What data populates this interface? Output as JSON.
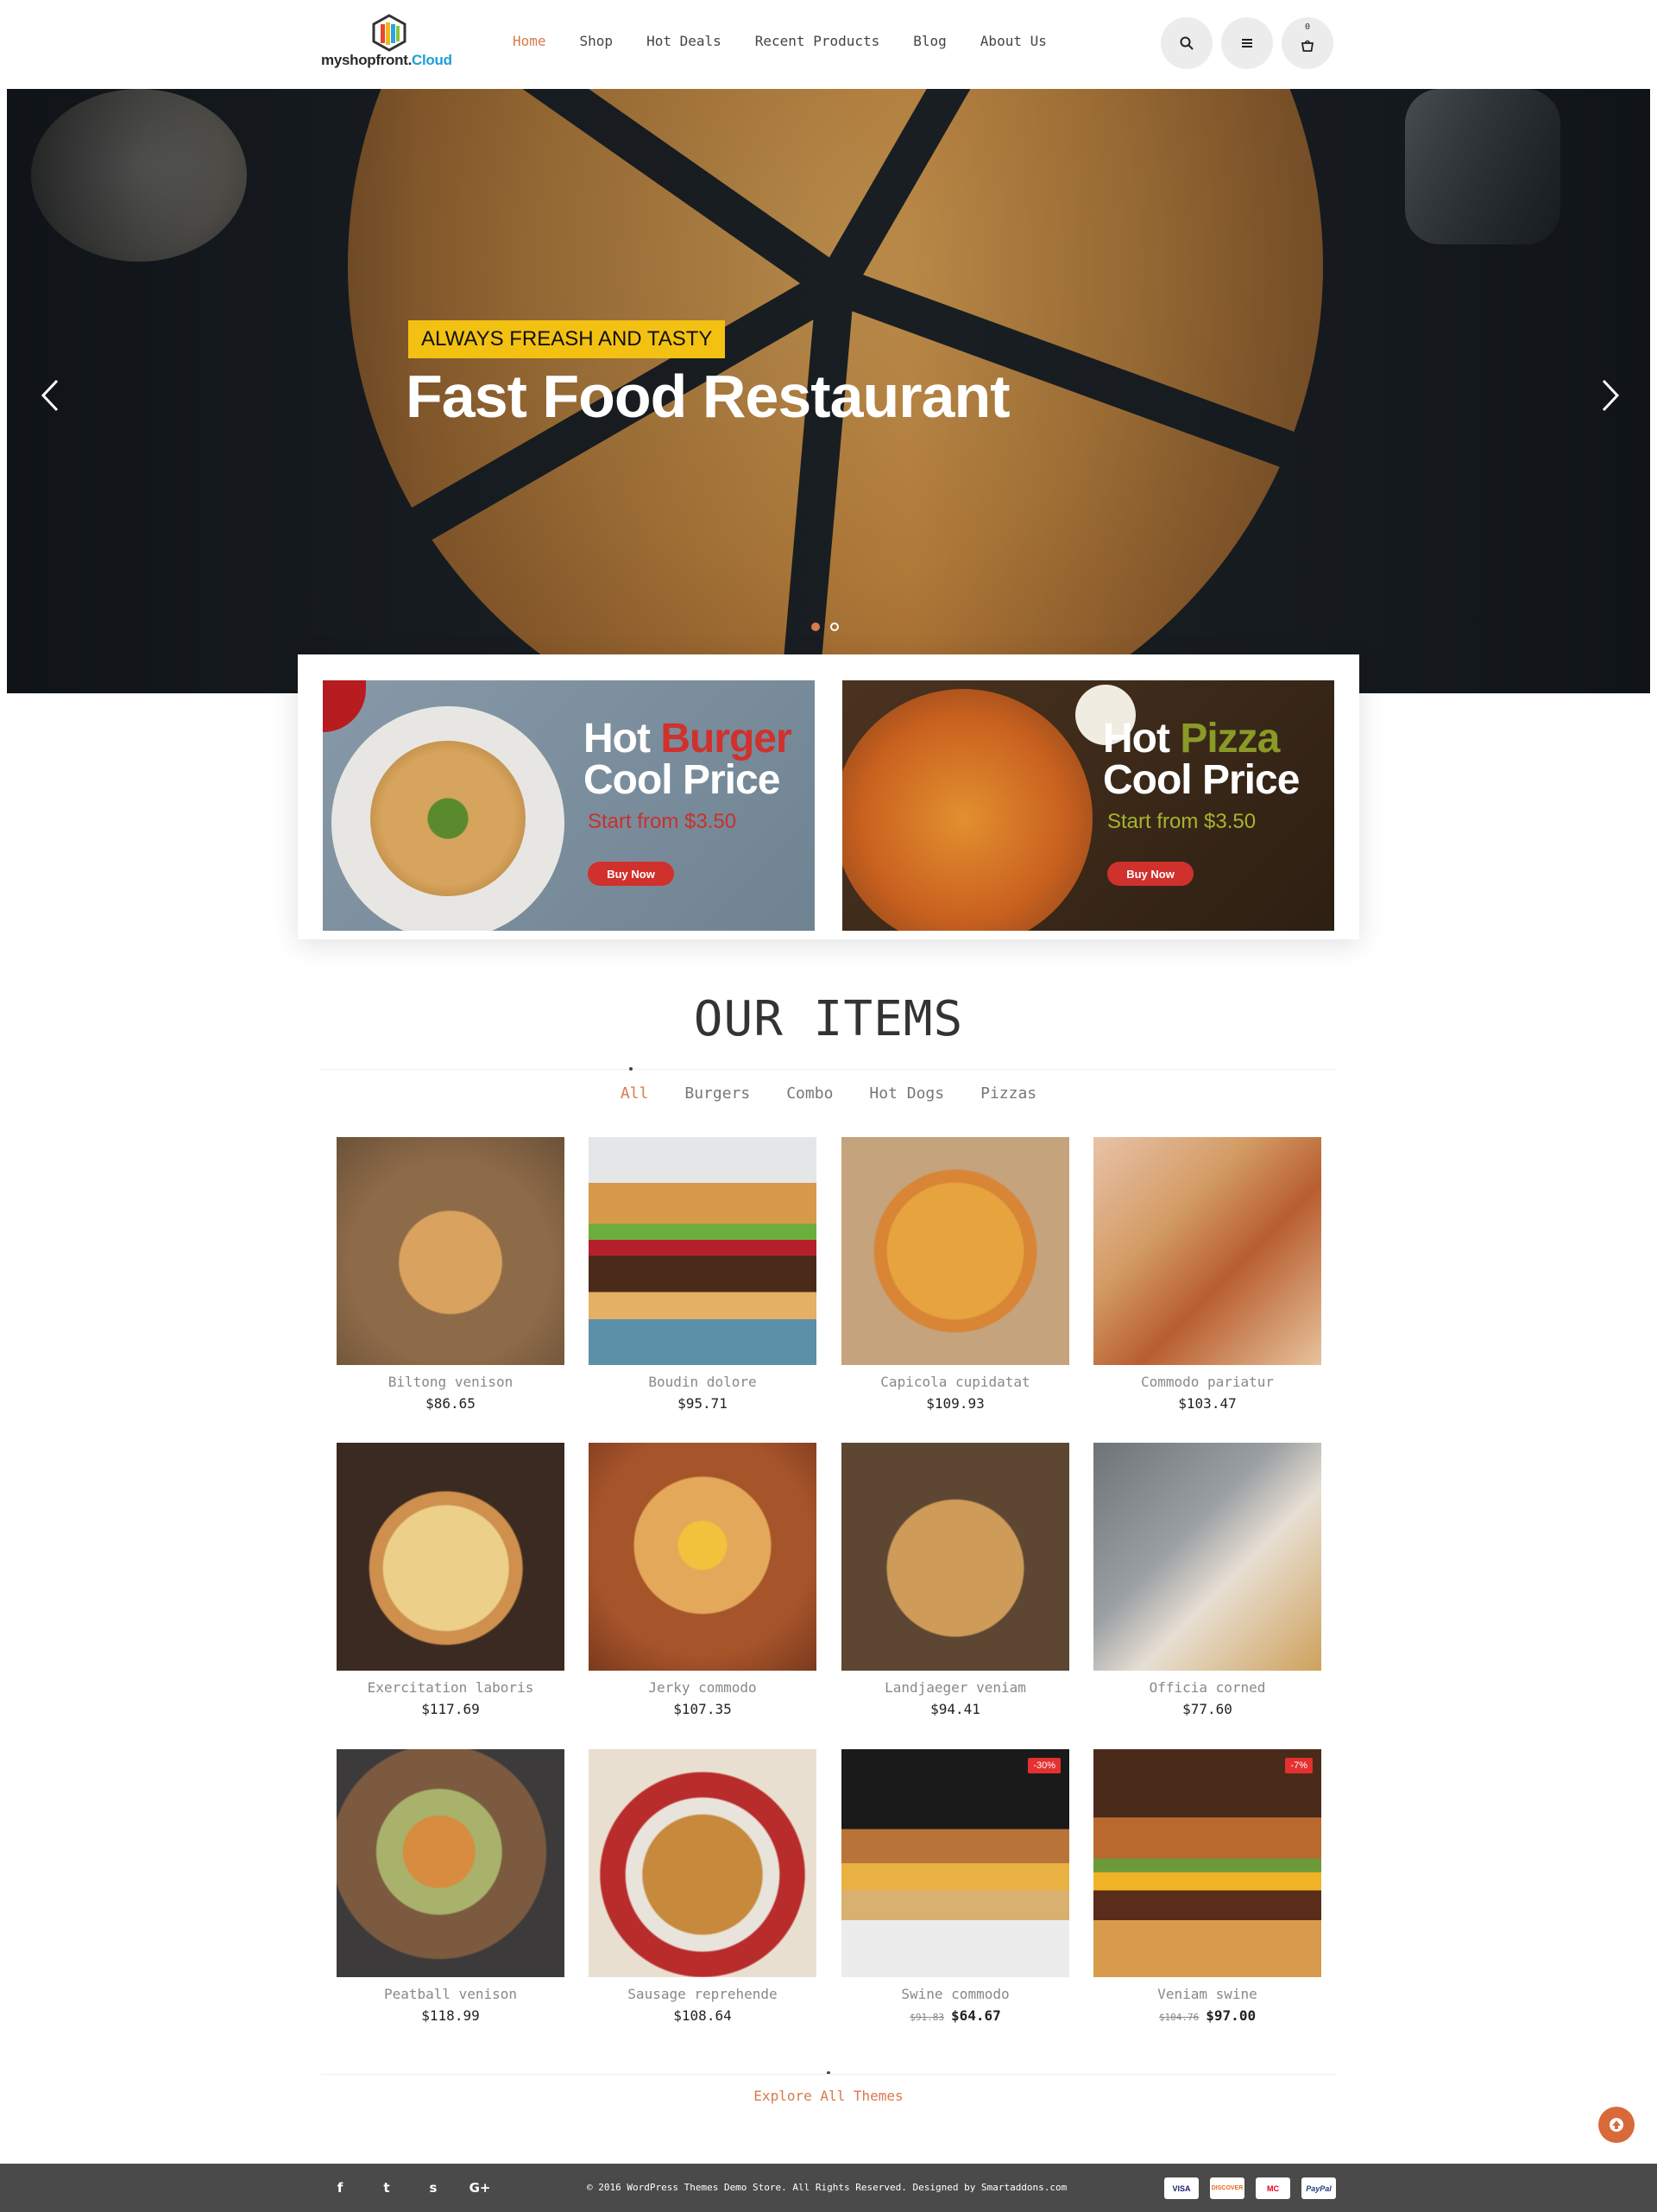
{
  "logo": {
    "text_main": "myshopfront.",
    "text_accent": "Cloud"
  },
  "nav": [
    {
      "label": "Home",
      "active": true
    },
    {
      "label": "Shop",
      "active": false
    },
    {
      "label": "Hot Deals",
      "active": false
    },
    {
      "label": "Recent Products",
      "active": false
    },
    {
      "label": "Blog",
      "active": false
    },
    {
      "label": "About Us",
      "active": false
    }
  ],
  "header": {
    "cart_count": "0",
    "search_icon": "search-icon",
    "menu_icon": "menu-icon",
    "cart_icon": "cart-icon"
  },
  "hero": {
    "tag": "ALWAYS FREASH AND TASTY",
    "title": "Fast Food Restaurant",
    "active_dot": 0,
    "dot_count": 2
  },
  "banners": [
    {
      "word1": "Hot ",
      "word2": "Burger",
      "line2": "Cool Price",
      "from": "Start from $3.50",
      "button": "Buy Now",
      "accent": "#d0312d",
      "from_color": "#c8312b"
    },
    {
      "word1": "Hot ",
      "word2": "Pizza",
      "line2": "Cool Price",
      "from": "Start from $3.50",
      "button": "Buy Now",
      "accent": "#8a9a26",
      "from_color": "#a5b52c"
    }
  ],
  "section": {
    "title": "OUR ITEMS",
    "explore": "Explore All Themes"
  },
  "filters": [
    {
      "label": "All",
      "active": true
    },
    {
      "label": "Burgers",
      "active": false
    },
    {
      "label": "Combo",
      "active": false
    },
    {
      "label": "Hot Dogs",
      "active": false
    },
    {
      "label": "Pizzas",
      "active": false
    }
  ],
  "products": [
    {
      "name": "Biltong venison",
      "price": "$86.65"
    },
    {
      "name": "Boudin dolore",
      "price": "$95.71"
    },
    {
      "name": "Capicola cupidatat",
      "price": "$109.93"
    },
    {
      "name": "Commodo pariatur",
      "price": "$103.47"
    },
    {
      "name": "Exercitation laboris",
      "price": "$117.69"
    },
    {
      "name": "Jerky commodo",
      "price": "$107.35"
    },
    {
      "name": "Landjaeger veniam",
      "price": "$94.41"
    },
    {
      "name": "Officia corned",
      "price": "$77.60"
    },
    {
      "name": "Peatball venison",
      "price": "$118.99"
    },
    {
      "name": "Sausage reprehende",
      "price": "$108.64"
    },
    {
      "name": "Swine commodo",
      "old_price": "$91.83",
      "price": "$64.67",
      "badge": "-30%"
    },
    {
      "name": "Veniam swine",
      "old_price": "$104.76",
      "price": "$97.00",
      "badge": "-7%"
    }
  ],
  "footer": {
    "copyright": "© 2016 WordPress Themes Demo Store. All Rights Reserved. Designed by Smartaddons.com",
    "social": [
      "f",
      "t",
      "s",
      "G+"
    ],
    "social_icons": [
      "facebook-icon",
      "twitter-icon",
      "skype-icon",
      "google-plus-icon"
    ],
    "payments": [
      "VISA",
      "DISCOVER",
      "MC",
      "PayPal"
    ]
  },
  "colors": {
    "accent": "#d87a4c",
    "tag_yellow": "#f3c112",
    "badge_red": "#e53030",
    "footer_bg": "#4a4a4a"
  }
}
